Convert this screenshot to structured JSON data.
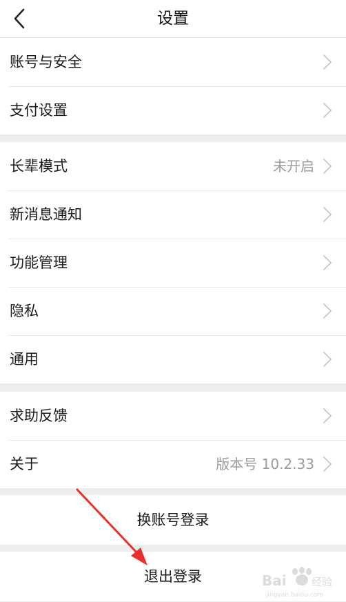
{
  "header": {
    "title": "设置",
    "back_icon": "chevron-left-icon"
  },
  "groups": [
    {
      "items": [
        {
          "label": "账号与安全"
        },
        {
          "label": "支付设置"
        }
      ]
    },
    {
      "items": [
        {
          "label": "长辈模式",
          "value": "未开启"
        },
        {
          "label": "新消息通知"
        },
        {
          "label": "功能管理"
        },
        {
          "label": "隐私"
        },
        {
          "label": "通用"
        }
      ]
    },
    {
      "items": [
        {
          "label": "求助反馈"
        },
        {
          "label": "关于",
          "value": "版本号 10.2.33"
        }
      ]
    }
  ],
  "actions": {
    "switch_account": "换账号登录",
    "logout": "退出登录"
  },
  "watermark": {
    "brand": "Bai",
    "brand_suffix": "经验",
    "url": "jingyan.baidu.com"
  },
  "colors": {
    "annotation_arrow": "#e8312b",
    "background": "#ededed",
    "chevron": "#c7c7c7"
  }
}
